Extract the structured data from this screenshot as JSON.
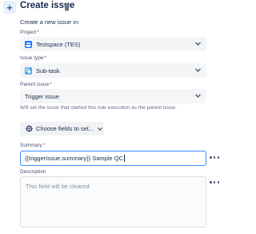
{
  "header": {
    "title": "Create issue",
    "subheading": "Create a new issue in:"
  },
  "project": {
    "label": "Project",
    "required_mark": "*",
    "value": "Testspace (TES)",
    "icon": "project-icon"
  },
  "issue_type": {
    "label": "Issue type",
    "required_mark": "*",
    "value": "Sub-task",
    "icon": "subtask-icon"
  },
  "parent_issue": {
    "label": "Parent issue",
    "required_mark": "*",
    "value": "Trigger issue",
    "helper": "Will set the issue that started this rule execution as the parent issue."
  },
  "choose_fields": {
    "label": "Choose fields to set..."
  },
  "summary": {
    "label": "Summary",
    "required_mark": "*",
    "value": "{{triggerIssue.summary}} Sample QC"
  },
  "description": {
    "label": "Description",
    "placeholder": "This field will be cleared"
  },
  "colors": {
    "accent": "#388bff",
    "required": "#c9372c",
    "text": "#172b4d"
  }
}
